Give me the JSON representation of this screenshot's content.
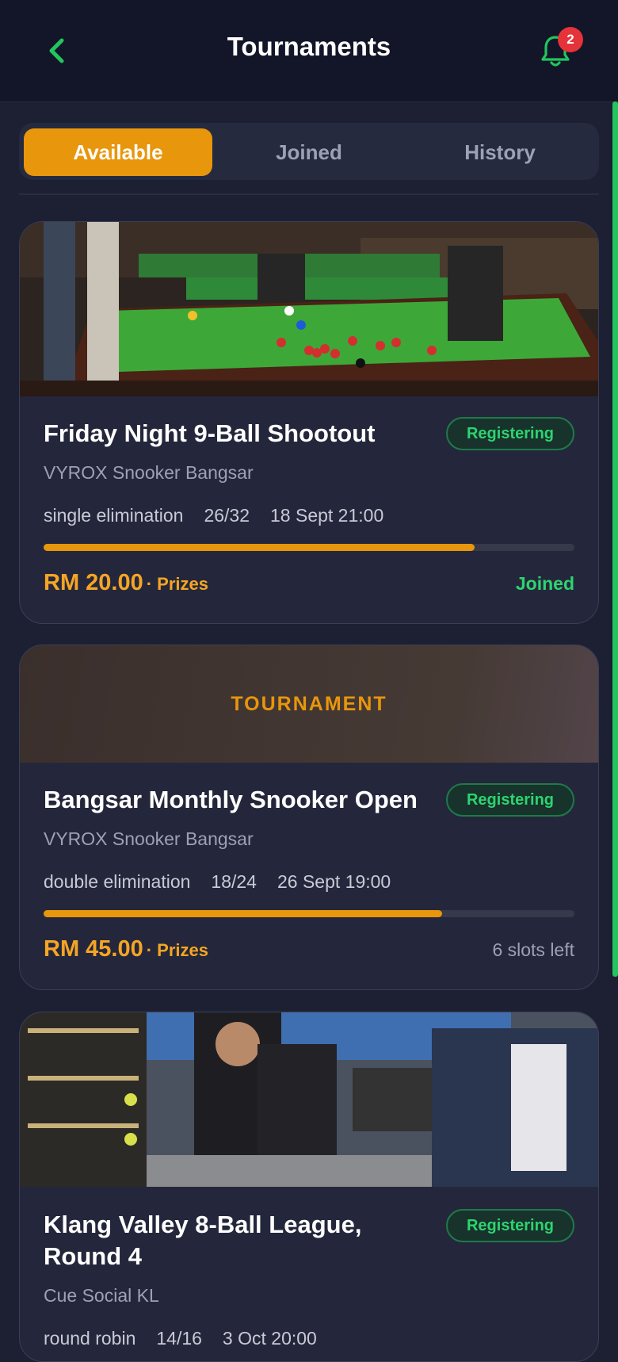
{
  "header": {
    "title": "Tournaments",
    "notification_count": "2"
  },
  "tabs": [
    {
      "label": "Available",
      "active": true
    },
    {
      "label": "Joined",
      "active": false
    },
    {
      "label": "History",
      "active": false
    }
  ],
  "tournaments": [
    {
      "name": "Friday Night 9-Ball Shootout",
      "status": "Registering",
      "venue": "VYROX Snooker Bangsar",
      "format": "single elimination",
      "slots": "26/32",
      "datetime": "18 Sept 21:00",
      "fill_fraction": 0.8125,
      "fee": "RM 20.00",
      "prizes": "· Prizes",
      "note": "Joined",
      "image": "snooker-hall-photo"
    },
    {
      "name": "Bangsar Monthly Snooker Open",
      "status": "Registering",
      "venue": "VYROX Snooker Bangsar",
      "format": "double elimination",
      "slots": "18/24",
      "datetime": "26 Sept 19:00",
      "fill_fraction": 0.75,
      "fee": "RM 45.00",
      "prizes": "· Prizes",
      "note": "6 slots left",
      "placeholder_label": "TOURNAMENT"
    },
    {
      "name": "Klang Valley 8-Ball League, Round 4",
      "status": "Registering",
      "venue": "Cue Social KL",
      "format": "round robin",
      "slots": "14/16",
      "datetime": "3 Oct 20:00",
      "image": "pro-shop-counter-photo"
    }
  ],
  "colors": {
    "accent": "#e8960c",
    "status_green": "#2ed36f",
    "background": "#1d2033",
    "card": "#24273b"
  }
}
